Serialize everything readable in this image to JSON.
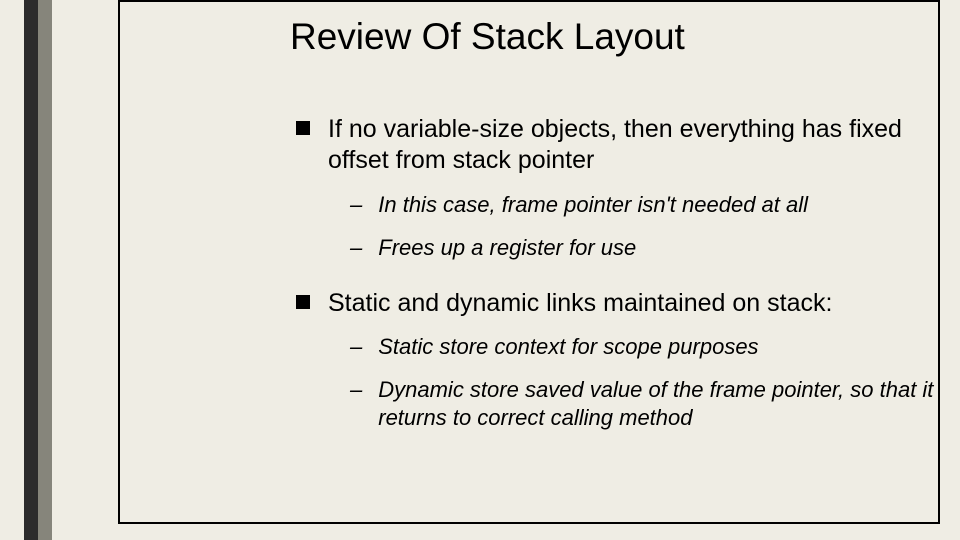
{
  "slide": {
    "title": "Review Of Stack Layout",
    "items": [
      {
        "level": 1,
        "text": "If no variable-size objects, then everything has fixed offset from stack pointer"
      },
      {
        "level": 2,
        "text": "In this case, frame pointer isn't needed at all"
      },
      {
        "level": 2,
        "text": "Frees up a register for use"
      },
      {
        "level": 1,
        "text": "Static and dynamic links maintained on stack:"
      },
      {
        "level": 2,
        "text": "Static store context for scope purposes"
      },
      {
        "level": 2,
        "text": "Dynamic store saved value of the frame pointer, so that it returns to correct calling method"
      }
    ]
  }
}
